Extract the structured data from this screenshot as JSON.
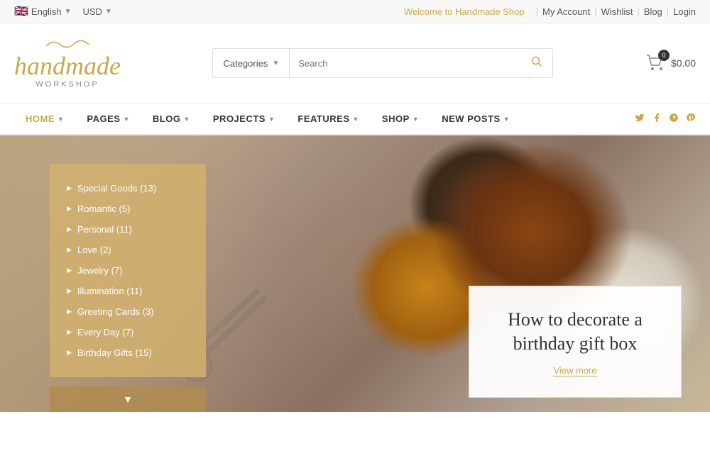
{
  "topbar": {
    "language": "English",
    "currency": "USD",
    "welcome": "Welcome to Handmade Shop",
    "links": [
      "My Account",
      "Wishlist",
      "Blog",
      "Login"
    ]
  },
  "header": {
    "logo_swirl": "〜",
    "logo_text": "handmade",
    "logo_sub": "workshop",
    "search_placeholder": "Search",
    "categories_label": "Categories",
    "cart_badge": "0",
    "cart_price": "$0.00"
  },
  "nav": {
    "items": [
      {
        "label": "HOME",
        "arrow": true
      },
      {
        "label": "PAGES",
        "arrow": true
      },
      {
        "label": "BLOG",
        "arrow": true
      },
      {
        "label": "PROJECTS",
        "arrow": true
      },
      {
        "label": "FEATURES",
        "arrow": true
      },
      {
        "label": "SHOP",
        "arrow": true
      },
      {
        "label": "NEW POSTS",
        "arrow": true
      }
    ],
    "socials": [
      "twitter",
      "facebook",
      "tumblr",
      "pinterest"
    ]
  },
  "sidebar": {
    "categories": [
      {
        "label": "Special Goods",
        "count": "(13)"
      },
      {
        "label": "Romantic",
        "count": "(5)"
      },
      {
        "label": "Personal",
        "count": "(11)"
      },
      {
        "label": "Love",
        "count": "(2)"
      },
      {
        "label": "Jewelry",
        "count": "(7)"
      },
      {
        "label": "Illumination",
        "count": "(11)"
      },
      {
        "label": "Greeting Cards",
        "count": "(3)"
      },
      {
        "label": "Every Day",
        "count": "(7)"
      },
      {
        "label": "Birthday Gifts",
        "count": "(15)"
      }
    ]
  },
  "hero": {
    "title": "How to decorate a birthday gift box",
    "view_more": "View more"
  },
  "colors": {
    "accent": "#c9a84c",
    "sidebar_bg": "rgba(210,175,110,0.88)"
  }
}
